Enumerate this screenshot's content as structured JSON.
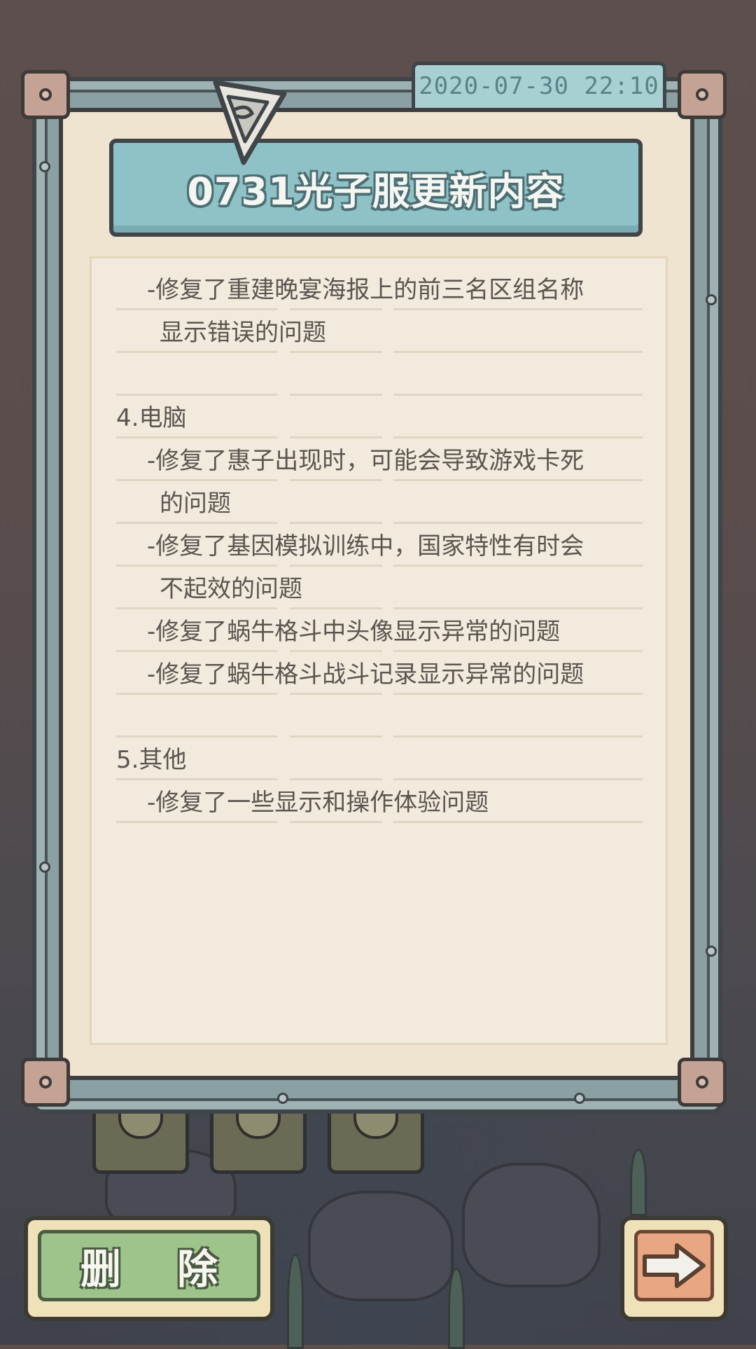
{
  "notice": {
    "datetime": "2020-07-30  22:10",
    "title": "0731光子服更新内容",
    "lines": [
      {
        "text": "-修复了重建晚宴海报上的前三名区组名称",
        "indent": 1
      },
      {
        "text": "显示错误的问题",
        "indent": 2
      },
      {
        "text": "",
        "indent": 0
      },
      {
        "text": "4.电脑",
        "indent": 0
      },
      {
        "text": "-修复了惠子出现时，可能会导致游戏卡死",
        "indent": 1
      },
      {
        "text": "的问题",
        "indent": 2
      },
      {
        "text": "-修复了基因模拟训练中，国家特性有时会",
        "indent": 1
      },
      {
        "text": "不起效的问题",
        "indent": 2
      },
      {
        "text": "-修复了蜗牛格斗中头像显示异常的问题",
        "indent": 1
      },
      {
        "text": "-修复了蜗牛格斗战斗记录显示异常的问题",
        "indent": 1
      },
      {
        "text": "",
        "indent": 0
      },
      {
        "text": "5.其他",
        "indent": 0
      },
      {
        "text": "-修复了一些显示和操作体验问题",
        "indent": 1
      }
    ]
  },
  "buttons": {
    "delete_label": "删 除",
    "next_icon": "right-arrow-icon"
  },
  "colors": {
    "paper": "#efe4cf",
    "banner": "#8fc2c6",
    "date_tab": "#a8cfd2",
    "delete_button": "#9ec48b",
    "next_button": "#e8a682",
    "text": "#5a5550"
  }
}
